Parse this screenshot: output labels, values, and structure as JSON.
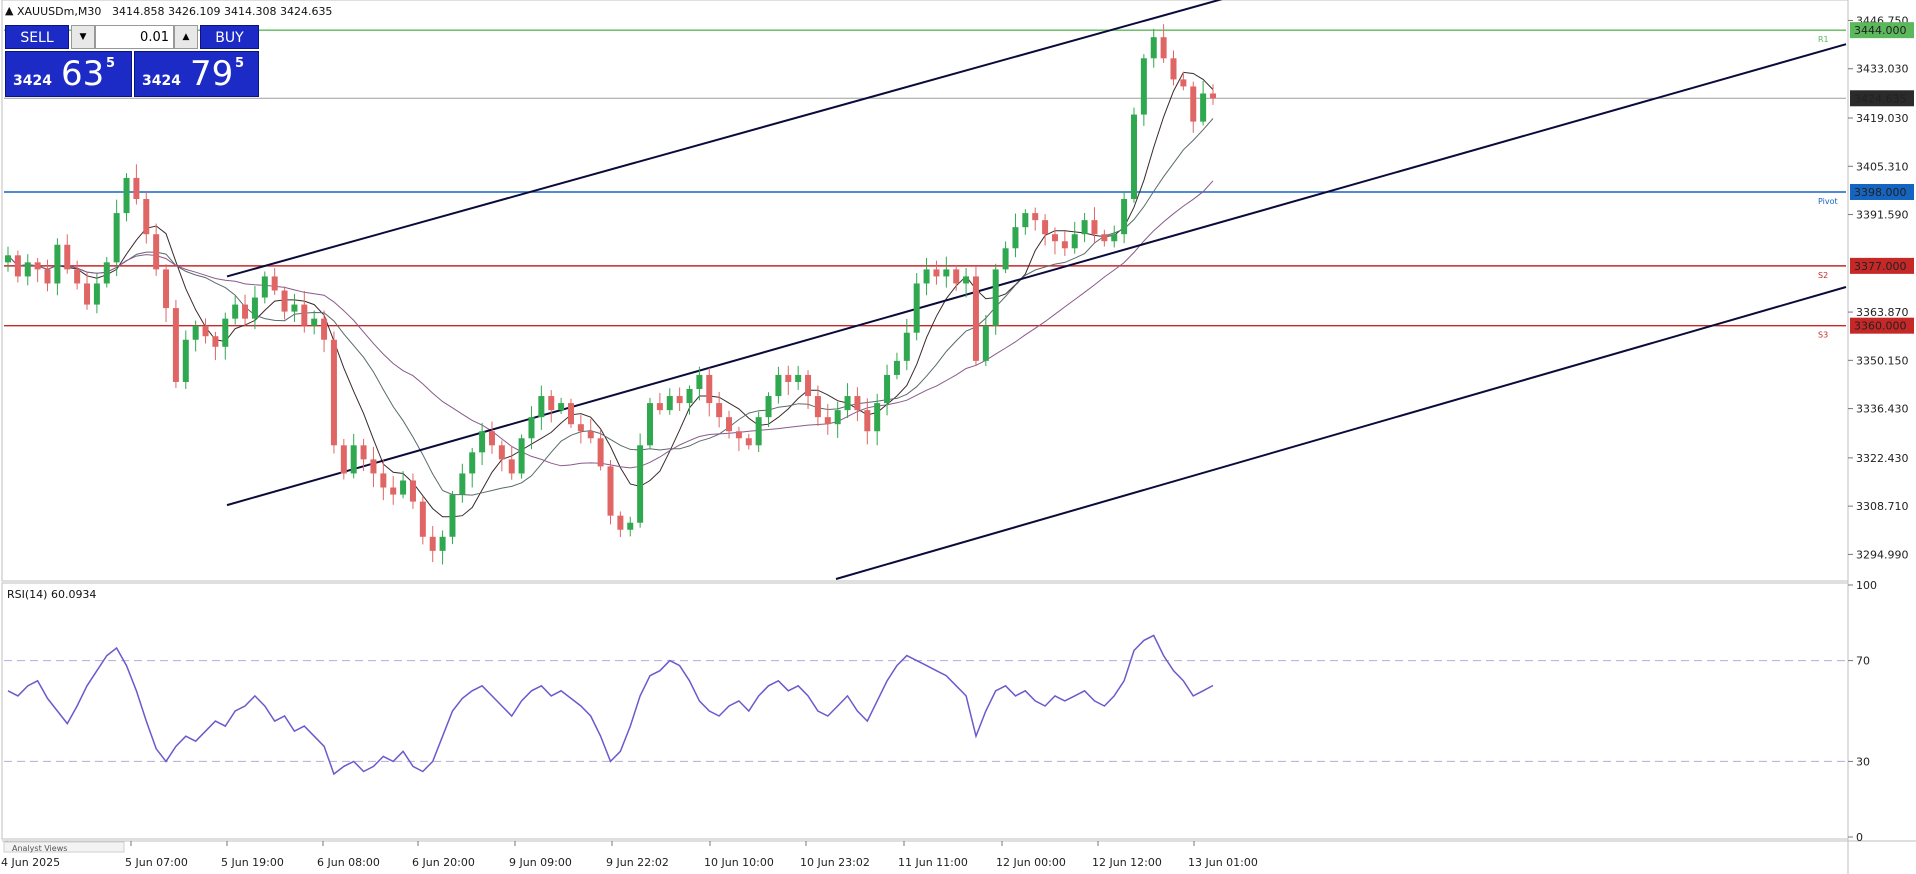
{
  "header": {
    "symbol": "XAUUSDm,M30",
    "ohlc": "3414.858 3426.109 3414.308 3424.635"
  },
  "trade_panel": {
    "sell_label": "SELL",
    "buy_label": "BUY",
    "volume": "0.01",
    "sell_price_small": "3424",
    "sell_price_big": "63",
    "sell_price_sup": "5",
    "buy_price_small": "3424",
    "buy_price_big": "79",
    "buy_price_sup": "5"
  },
  "colors": {
    "bull": "#2fa84f",
    "bear": "#e06666",
    "resistance": "#5cb85c",
    "pivot": "#1565c0",
    "support": "#c62828",
    "channel": "#0b0b3b",
    "rsi_line": "#6a5acd",
    "current_price": "#2b2b2b"
  },
  "chart_data": {
    "type": "candlestick",
    "instrument": "XAUUSDm",
    "timeframe": "M30",
    "ylim": [
      3288,
      3452
    ],
    "y_ticks": [
      "3446.750",
      "3433.030",
      "3419.030",
      "3405.310",
      "3391.590",
      "3363.870",
      "3350.150",
      "3336.430",
      "3322.430",
      "3308.710",
      "3294.990"
    ],
    "x_ticks": [
      "4 Jun 2025",
      "5 Jun 07:00",
      "5 Jun 19:00",
      "6 Jun 08:00",
      "6 Jun 20:00",
      "9 Jun 09:00",
      "9 Jun 22:02",
      "10 Jun 10:00",
      "10 Jun 23:02",
      "11 Jun 11:00",
      "12 Jun 00:00",
      "12 Jun 12:00",
      "13 Jun 01:00"
    ],
    "current_price": "3424.635",
    "levels": [
      {
        "name": "R1",
        "price": 3444.0,
        "label": "3444.000",
        "kind": "resistance"
      },
      {
        "name": "Pivot",
        "price": 3398.0,
        "label": "3398.000",
        "kind": "pivot"
      },
      {
        "name": "S2",
        "price": 3377.0,
        "label": "3377.000",
        "kind": "support"
      },
      {
        "name": "S3",
        "price": 3360.0,
        "label": "3360.000",
        "kind": "support"
      }
    ],
    "channel_lines": [
      {
        "name": "upper",
        "from": [
          "5 Jun 19:00",
          3374
        ],
        "to": [
          "13 Jun 04:00",
          3454
        ]
      },
      {
        "name": "middle",
        "from": [
          "5 Jun 19:00",
          3309
        ],
        "to": [
          "13 Jun 22:00",
          3440
        ]
      },
      {
        "name": "lower",
        "from": [
          "10 Jun 09:00",
          3288
        ],
        "to": [
          "13 Jun 22:00",
          3371
        ]
      }
    ],
    "candles_close_path": [
      3380,
      3374,
      3378,
      3376,
      3372,
      3383,
      3376,
      3372,
      3366,
      3372,
      3378,
      3392,
      3402,
      3396,
      3386,
      3376,
      3365,
      3344,
      3356,
      3360,
      3357,
      3354,
      3362,
      3366,
      3362,
      3368,
      3374,
      3370,
      3364,
      3366,
      3360,
      3362,
      3356,
      3326,
      3318,
      3326,
      3322,
      3318,
      3314,
      3312,
      3316,
      3310,
      3300,
      3296,
      3300,
      3312,
      3318,
      3324,
      3330,
      3326,
      3322,
      3318,
      3328,
      3334,
      3340,
      3336,
      3338,
      3332,
      3330,
      3328,
      3320,
      3306,
      3302,
      3304,
      3326,
      3338,
      3336,
      3340,
      3338,
      3342,
      3346,
      3338,
      3334,
      3330,
      3328,
      3326,
      3334,
      3340,
      3346,
      3344,
      3346,
      3340,
      3334,
      3332,
      3336,
      3340,
      3336,
      3330,
      3338,
      3346,
      3350,
      3358,
      3372,
      3376,
      3374,
      3376,
      3372,
      3374,
      3350,
      3360,
      3376,
      3382,
      3388,
      3392,
      3390,
      3386,
      3384,
      3382,
      3386,
      3390,
      3386,
      3384,
      3386,
      3396,
      3420,
      3436,
      3442,
      3436,
      3430,
      3428,
      3418,
      3426,
      3424.6
    ],
    "rsi": {
      "label": "RSI(14) 60.0934",
      "period": 14,
      "value": 60.0934,
      "ylim": [
        0,
        100
      ],
      "y_ticks": [
        "100",
        "70",
        "30",
        "0"
      ],
      "levels": [
        70,
        30
      ],
      "values": [
        58,
        56,
        60,
        62,
        55,
        50,
        45,
        52,
        60,
        66,
        72,
        75,
        68,
        58,
        46,
        35,
        30,
        36,
        40,
        38,
        42,
        46,
        44,
        50,
        52,
        56,
        52,
        46,
        48,
        42,
        44,
        40,
        36,
        25,
        28,
        30,
        26,
        28,
        32,
        30,
        34,
        28,
        26,
        30,
        40,
        50,
        55,
        58,
        60,
        56,
        52,
        48,
        54,
        58,
        60,
        56,
        58,
        55,
        52,
        48,
        40,
        30,
        34,
        44,
        56,
        64,
        66,
        70,
        68,
        62,
        54,
        50,
        48,
        52,
        54,
        50,
        56,
        60,
        62,
        58,
        60,
        56,
        50,
        48,
        52,
        56,
        50,
        46,
        54,
        62,
        68,
        72,
        70,
        68,
        66,
        64,
        60,
        56,
        40,
        50,
        58,
        60,
        56,
        58,
        54,
        52,
        56,
        54,
        56,
        58,
        54,
        52,
        56,
        62,
        74,
        78,
        80,
        72,
        66,
        62,
        56,
        58,
        60.1
      ]
    },
    "footer_tab": "Analyst Views"
  }
}
